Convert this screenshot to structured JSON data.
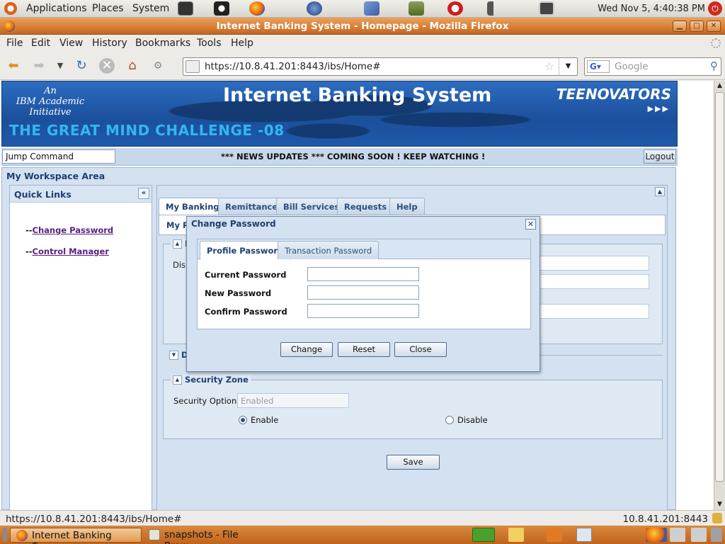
{
  "top_panel": {
    "menus": [
      "Applications",
      "Places",
      "System"
    ],
    "clock": "Wed Nov  5,  4:40:38 PM"
  },
  "window": {
    "title": "Internet Banking System - Homepage - Mozilla Firefox"
  },
  "menubar": [
    "File",
    "Edit",
    "View",
    "History",
    "Bookmarks",
    "Tools",
    "Help"
  ],
  "navbar": {
    "url": "https://10.8.41.201:8443/ibs/Home#",
    "search_placeholder": "Google"
  },
  "banner": {
    "ibm_lines": [
      "An",
      "IBM Academic",
      "Initiative"
    ],
    "title": "Internet Banking System",
    "challenge": "THE GREAT MIND CHALLENGE -08",
    "brand": "TEENOVATORS",
    "brand_arrows": "▶▶▶"
  },
  "newsbar": {
    "jump_placeholder": "Jump Command",
    "news": "*** NEWS UPDATES *** COMING SOON ! KEEP WATCHING !",
    "logout": "Logout"
  },
  "workspace": {
    "title": "My Workspace Area",
    "quick_links_title": "Quick Links",
    "quick_links": [
      {
        "prefix": "--",
        "label": "Change Password"
      },
      {
        "prefix": "--",
        "label": "Control Manager"
      }
    ],
    "tabs": [
      "My Banking",
      "Remittance",
      "Bill Services",
      "Requests",
      "Help"
    ],
    "active_tab": "My Banking",
    "subtab_partial": "My Pr",
    "profile_section_partial": "P",
    "display_partial": "Disp",
    "d_section_partial": "D",
    "security": {
      "legend": "Security Zone",
      "option_label": "Security Option:",
      "option_value": "Enabled",
      "radios": [
        {
          "label": "Enable",
          "checked": true
        },
        {
          "label": "Disable",
          "checked": false
        }
      ]
    },
    "save": "Save"
  },
  "modal": {
    "title": "Change Password",
    "tabs": [
      "Profile Password",
      "Transaction Password"
    ],
    "active_tab": "Profile Password",
    "fields": [
      {
        "label": "Current Password",
        "value": ""
      },
      {
        "label": "New Password",
        "value": ""
      },
      {
        "label": "Confirm Password",
        "value": ""
      }
    ],
    "buttons": [
      "Change",
      "Reset",
      "Close"
    ]
  },
  "statusbar": {
    "left": "https://10.8.41.201:8443/ibs/Home#",
    "right": "10.8.41.201:8443"
  },
  "taskbar": [
    {
      "label": "Internet Banking Sys...",
      "active": true
    },
    {
      "label": "snapshots - File Brow...",
      "active": false
    }
  ]
}
